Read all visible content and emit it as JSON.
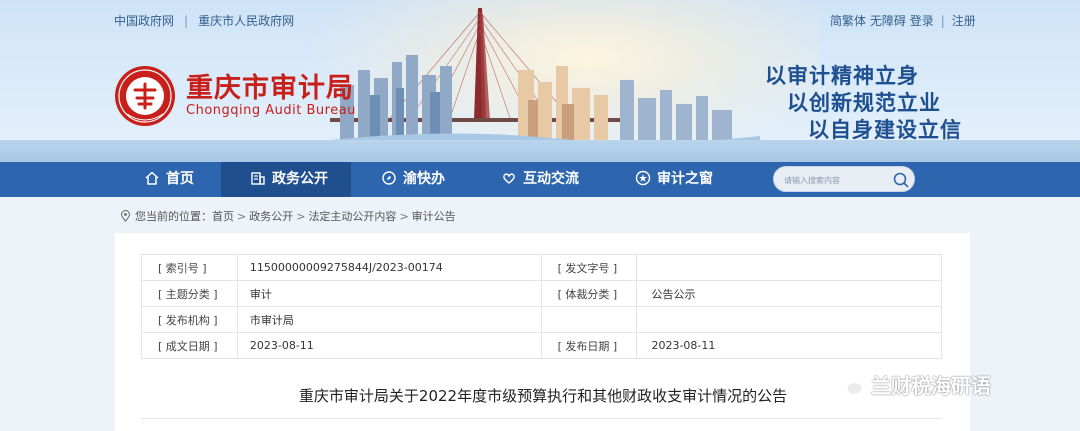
{
  "header": {
    "top_links": [
      "中国政府网",
      "重庆市人民政府网"
    ],
    "right_links": [
      "简繁体",
      "无障碍",
      "登录",
      "注册"
    ],
    "logo_cn": "重庆市审计局",
    "logo_en": "Chongqing Audit Bureau",
    "slogans": [
      "以审计精神立身",
      "以创新规范立业",
      "以自身建设立信"
    ]
  },
  "nav": {
    "items": [
      {
        "label": "首页",
        "icon": "home-icon"
      },
      {
        "label": "政务公开",
        "icon": "building-icon"
      },
      {
        "label": "渝快办",
        "icon": "compass-icon"
      },
      {
        "label": "互动交流",
        "icon": "heart-hands-icon"
      },
      {
        "label": "审计之窗",
        "icon": "star-circle-icon"
      }
    ],
    "active": "政务公开",
    "search_placeholder": "请输入搜索内容"
  },
  "breadcrumb": {
    "prefix": "您当前的位置：",
    "items": [
      "首页",
      "政务公开",
      "法定主动公开内容",
      "审计公告"
    ]
  },
  "meta": {
    "rows": [
      {
        "k1": "[ 索引号 ]",
        "v1": "11500000009275844J/2023-00174",
        "k2": "[ 发文字号 ]",
        "v2": ""
      },
      {
        "k1": "[ 主题分类 ]",
        "v1": "审计",
        "k2": "[ 体裁分类 ]",
        "v2": "公告公示"
      },
      {
        "k1": "[ 发布机构 ]",
        "v1": "市审计局",
        "k2": "",
        "v2": ""
      },
      {
        "k1": "[ 成文日期 ]",
        "v1": "2023-08-11",
        "k2": "[ 发布日期 ]",
        "v2": "2023-08-11"
      }
    ]
  },
  "document": {
    "title": "重庆市审计局关于2022年度市级预算执行和其他财政收支审计情况的公告"
  },
  "watermark": "兰财税海研语",
  "colors": {
    "nav_bg": "#2d66ae",
    "nav_active": "#1f4f8f",
    "brand_red": "#c81f1a",
    "slogan_blue": "#1e4f8f"
  }
}
